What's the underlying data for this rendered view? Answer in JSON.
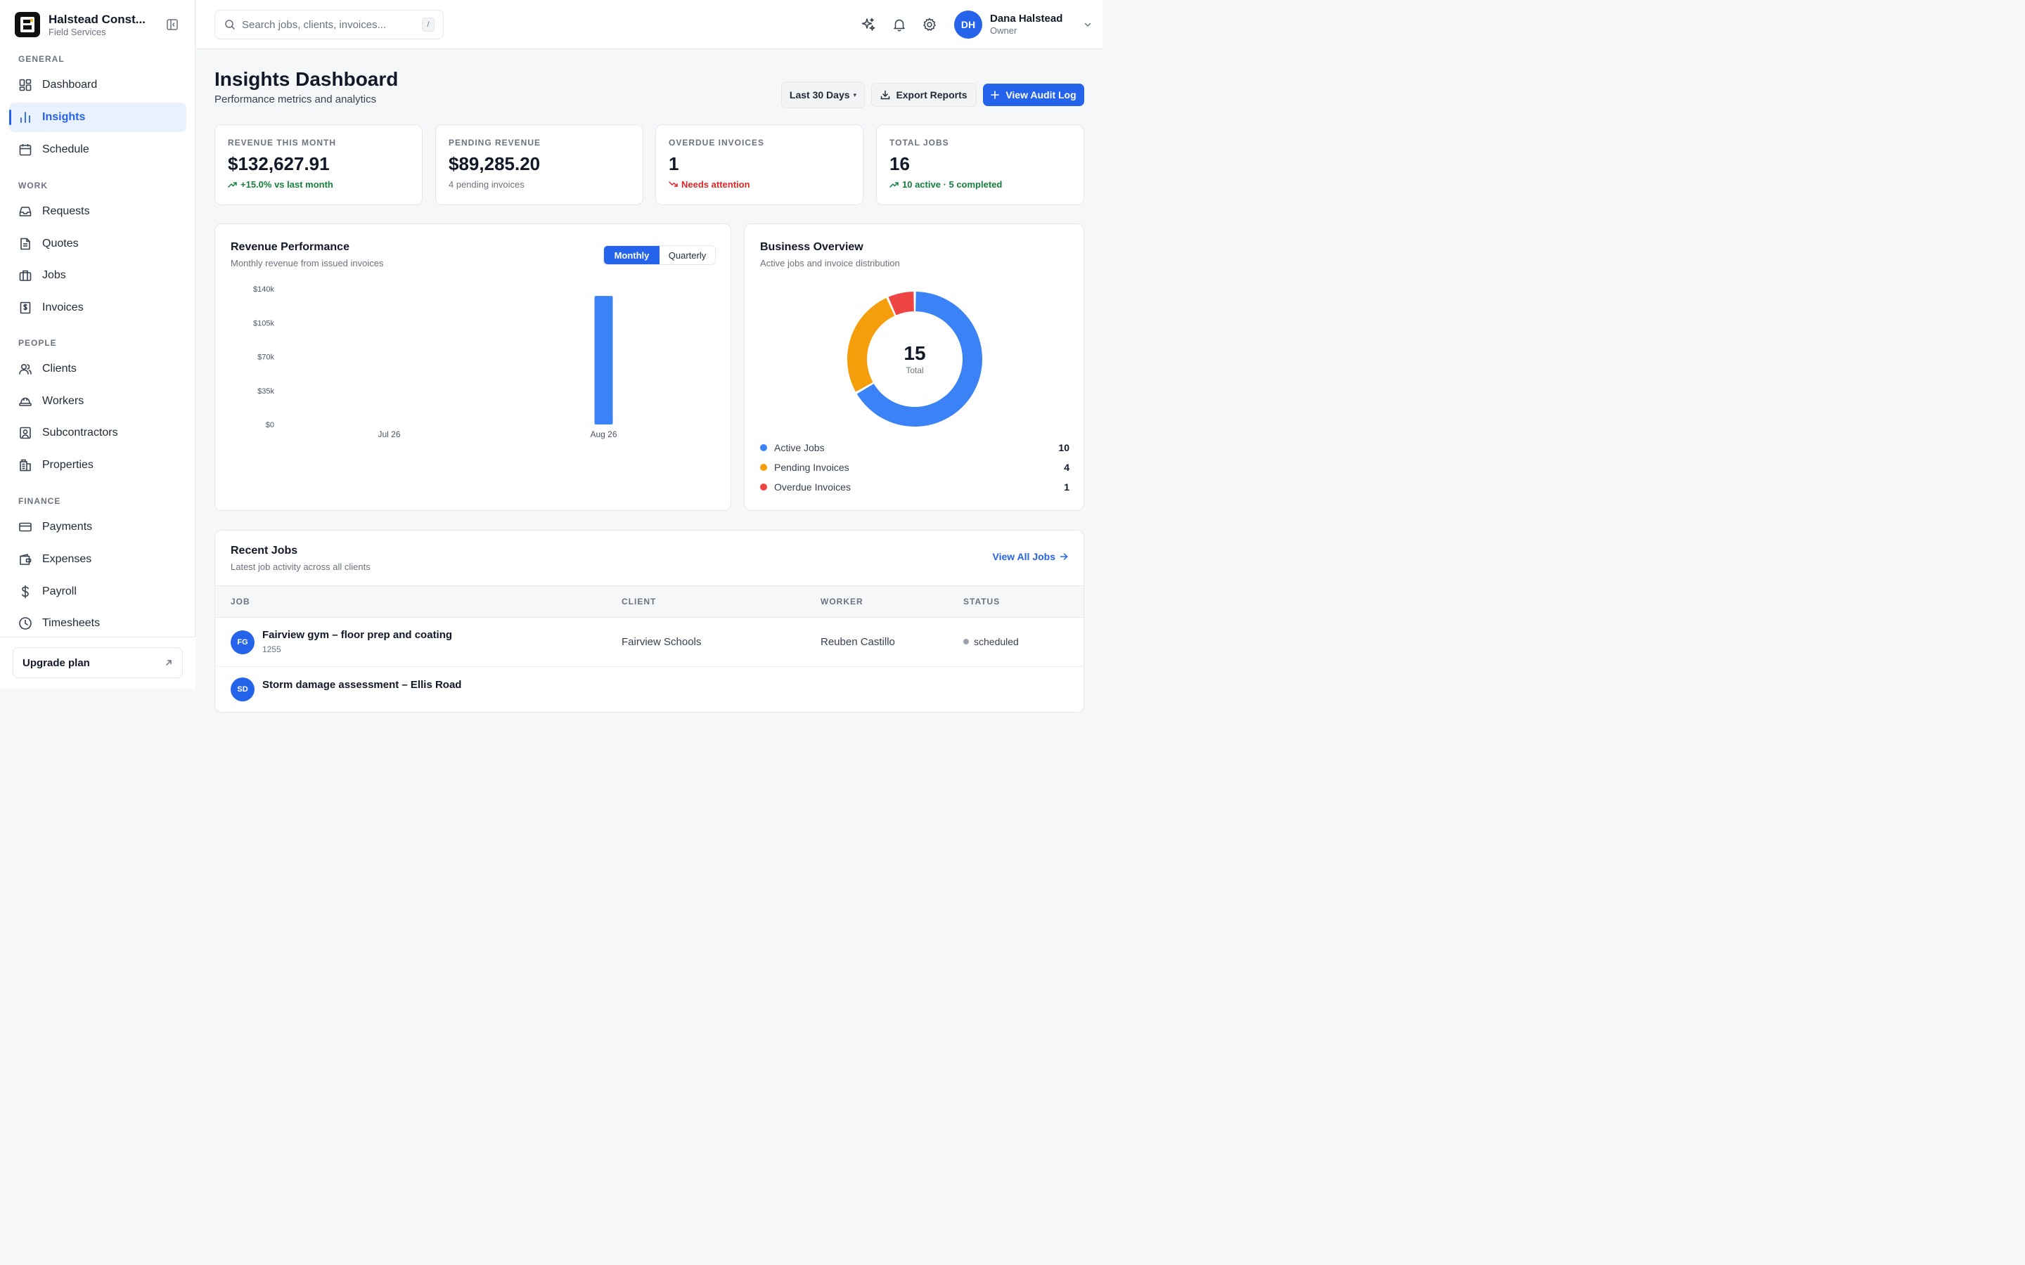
{
  "brand": {
    "name": "Halstead Const...",
    "subtitle": "Field Services"
  },
  "sidebar": {
    "sections": {
      "general": "GENERAL",
      "work": "WORK",
      "people": "PEOPLE",
      "finance": "FINANCE"
    },
    "items": {
      "dashboard": "Dashboard",
      "insights": "Insights",
      "schedule": "Schedule",
      "requests": "Requests",
      "quotes": "Quotes",
      "jobs": "Jobs",
      "invoices": "Invoices",
      "clients": "Clients",
      "workers": "Workers",
      "subcontractors": "Subcontractors",
      "properties": "Properties",
      "payments": "Payments",
      "expenses": "Expenses",
      "payroll": "Payroll",
      "timesheets": "Timesheets"
    },
    "active": "insights",
    "upgrade_label": "Upgrade plan"
  },
  "topbar": {
    "search_placeholder": "Search jobs, clients, invoices...",
    "search_shortcut": "/",
    "user": {
      "initials": "DH",
      "name": "Dana Halstead",
      "role": "Owner"
    }
  },
  "page": {
    "title": "Insights Dashboard",
    "subtitle": "Performance metrics and analytics",
    "range_label": "Last 30 Days",
    "range_caret": "▾",
    "export_label": "Export Reports",
    "audit_label": "View Audit Log"
  },
  "stats": [
    {
      "label": "REVENUE THIS MONTH",
      "value": "$132,627.91",
      "note": "+15.0% vs last month",
      "tone": "up"
    },
    {
      "label": "PENDING REVENUE",
      "value": "$89,285.20",
      "note": "4 pending invoices",
      "tone": "neutral"
    },
    {
      "label": "OVERDUE INVOICES",
      "value": "1",
      "note": "Needs attention",
      "tone": "down"
    },
    {
      "label": "TOTAL JOBS",
      "value": "16",
      "note": "10 active · 5 completed",
      "tone": "up"
    }
  ],
  "revenue": {
    "title": "Revenue Performance",
    "subtitle": "Monthly revenue from issued invoices",
    "toggle": {
      "monthly": "Monthly",
      "quarterly": "Quarterly",
      "active": "monthly"
    }
  },
  "overview": {
    "title": "Business Overview",
    "subtitle": "Active jobs and invoice distribution",
    "center_value": "15",
    "center_label": "Total",
    "legend": [
      {
        "label": "Active Jobs",
        "value": "10",
        "color": "#3b82f6"
      },
      {
        "label": "Pending Invoices",
        "value": "4",
        "color": "#f59e0b"
      },
      {
        "label": "Overdue Invoices",
        "value": "1",
        "color": "#ef4444"
      }
    ]
  },
  "chart_data": [
    {
      "type": "bar",
      "title": "Revenue Performance",
      "categories": [
        "Jul 26",
        "Aug 26"
      ],
      "values": [
        0,
        132627.91
      ],
      "ylim": [
        0,
        140000
      ],
      "yticks": [
        "$0",
        "$35k",
        "$70k",
        "$105k",
        "$140k"
      ],
      "ytick_values": [
        0,
        35000,
        70000,
        105000,
        140000
      ],
      "color": "#3b82f6",
      "grid": false
    },
    {
      "type": "pie",
      "title": "Business Overview",
      "categories": [
        "Active Jobs",
        "Pending Invoices",
        "Overdue Invoices"
      ],
      "values": [
        10,
        4,
        1
      ],
      "colors": [
        "#3b82f6",
        "#f59e0b",
        "#ef4444"
      ],
      "donut": true
    }
  ],
  "recent_jobs": {
    "title": "Recent Jobs",
    "subtitle": "Latest job activity across all clients",
    "view_all": "View All Jobs",
    "columns": [
      "JOB",
      "CLIENT",
      "WORKER",
      "STATUS"
    ],
    "rows": [
      {
        "initials": "FG",
        "title": "Fairview gym – floor prep and coating",
        "number": "1255",
        "client": "Fairview Schools",
        "worker": "Reuben Castillo",
        "status": "scheduled"
      },
      {
        "initials": "SD",
        "title": "Storm damage assessment – Ellis Road",
        "number": "",
        "client": "",
        "worker": "",
        "status": ""
      }
    ]
  },
  "colors": {
    "accent": "#2563eb",
    "success": "#15803d",
    "danger": "#dc2626"
  }
}
